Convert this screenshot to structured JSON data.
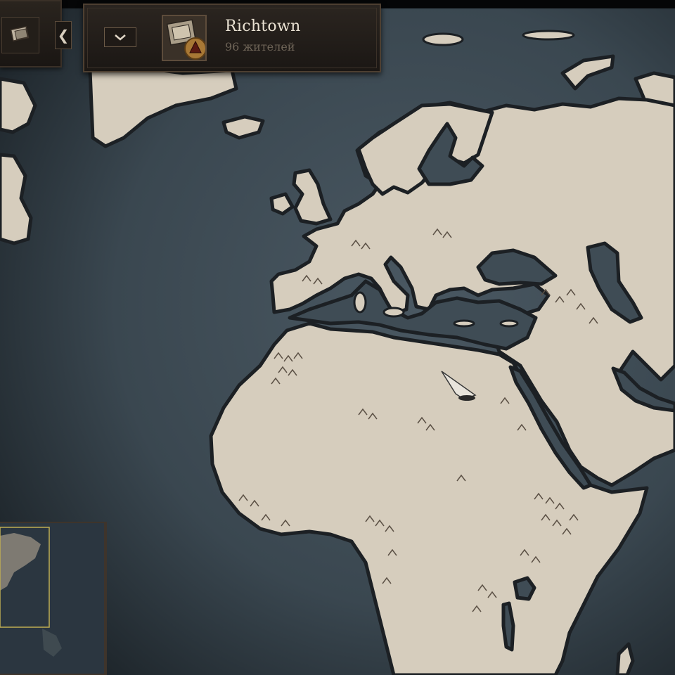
{
  "town": {
    "name": "Richtown",
    "population": "96 жителей"
  },
  "colors": {
    "ocean": "#3f4c55",
    "land": "#d6cdbd",
    "coast": "#1c2024",
    "panel": "#241f1a",
    "panel_border": "#4d3f31"
  },
  "icons": {
    "book": "book-icon",
    "collapse": "chevron-left-icon",
    "dropdown": "chevron-down-icon",
    "town": "town-emblem-icon",
    "cursor": "pointer-cursor-icon"
  }
}
